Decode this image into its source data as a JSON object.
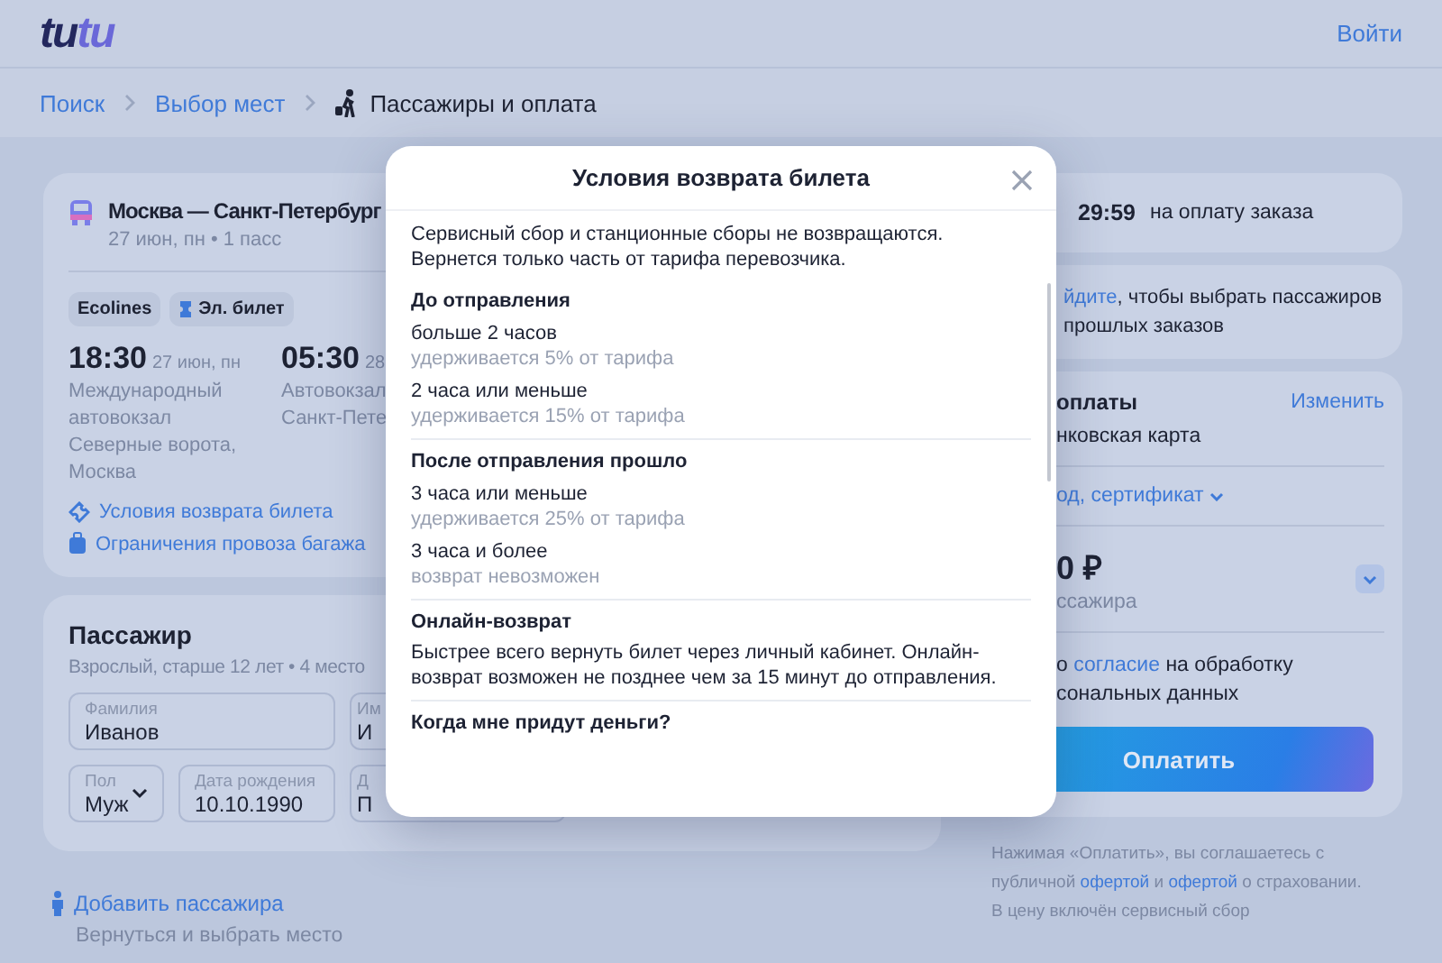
{
  "header": {
    "logo": [
      "tu",
      "tu"
    ],
    "login": "Войти"
  },
  "breadcrumbs": [
    {
      "label": "Поиск",
      "current": false
    },
    {
      "label": "Выбор мест",
      "current": false
    },
    {
      "label": "Пассажиры и оплата",
      "current": true
    }
  ],
  "trip": {
    "route": "Москва — Санкт-Петербург",
    "meta": "27 июн, пн • 1 пасс",
    "tags": [
      {
        "label": "Ecolines",
        "kind": "carrier"
      },
      {
        "label": "Эл. билет",
        "kind": "eticket"
      }
    ],
    "departure": {
      "time": "18:30",
      "date": "27 июн, пн",
      "station": "Международный автовокзал Северные ворота, Москва"
    },
    "arrival": {
      "time": "05:30",
      "date": "28",
      "station": "Автовокзал Санкт-Пете"
    },
    "links": [
      {
        "label": "Условия возврата билета",
        "kind": "refund"
      },
      {
        "label": "Ограничения провоза багажа",
        "kind": "baggage"
      }
    ]
  },
  "passenger": {
    "title": "Пассажир",
    "subtitle": "Взрослый, старше 12 лет • 4 место",
    "last_name": {
      "label": "Фамилия",
      "value": "Иванов"
    },
    "first_name": {
      "label": "Им",
      "value": "И"
    },
    "gender": {
      "label": "Пол",
      "value": "Муж"
    },
    "birth_date": {
      "label": "Дата рождения",
      "value": "10.10.1990"
    },
    "document": {
      "label": "Д",
      "value": "П"
    }
  },
  "add_passenger": {
    "label": "Добавить пассажира",
    "note": "Вернуться и выбрать место"
  },
  "timer": {
    "time": "29:59",
    "label": "на оплату заказа"
  },
  "login_hint": [
    {
      "kind": "link",
      "text": "йдите"
    },
    {
      "kind": "text",
      "text": ", чтобы выбрать пассажиров прошлых заказов"
    }
  ],
  "payment": {
    "title": "оплаты",
    "change": "Изменить",
    "method": "нковская карта",
    "promo": "од, сертификат",
    "price": "0 ₽",
    "price_note": "ссажира",
    "consent": [
      {
        "kind": "text",
        "text": "о "
      },
      {
        "kind": "link",
        "text": "согласие"
      },
      {
        "kind": "text",
        "text": " на обработку сональных данных"
      }
    ],
    "pay": "Оплатить"
  },
  "legal": [
    {
      "kind": "text",
      "text": "Нажимая «Оплатить», вы соглашаетесь с публичной "
    },
    {
      "kind": "link",
      "text": "офертой"
    },
    {
      "kind": "text",
      "text": " и "
    },
    {
      "kind": "link",
      "text": "офертой"
    },
    {
      "kind": "text",
      "text": " о страховании."
    }
  ],
  "legal_note": "В цену включён сервисный сбор",
  "refund_modal": {
    "title": "Условия возврата билета",
    "intro": "Сервисный сбор и станционные сборы не возвращаются. Вернется только часть от тарифа перевозчика.",
    "sections": [
      {
        "title": "До отправления",
        "items": [
          {
            "label": "больше 2 часов",
            "note": "удерживается 5% от тарифа"
          },
          {
            "label": "2 часа или меньше",
            "note": "удерживается 15% от тарифа"
          }
        ]
      },
      {
        "title": "После отправления прошло",
        "items": [
          {
            "label": "3 часа или меньше",
            "note": "удерживается 25% от тарифа"
          },
          {
            "label": "3 часа и более",
            "note": "возврат невозможен"
          }
        ]
      },
      {
        "title": "Онлайн-возврат",
        "text": "Быстрее всего вернуть билет через личный кабинет. Онлайн-возврат возможен не позднее чем за 15 минут до отправления."
      },
      {
        "title": "Когда мне придут деньги?"
      }
    ]
  }
}
